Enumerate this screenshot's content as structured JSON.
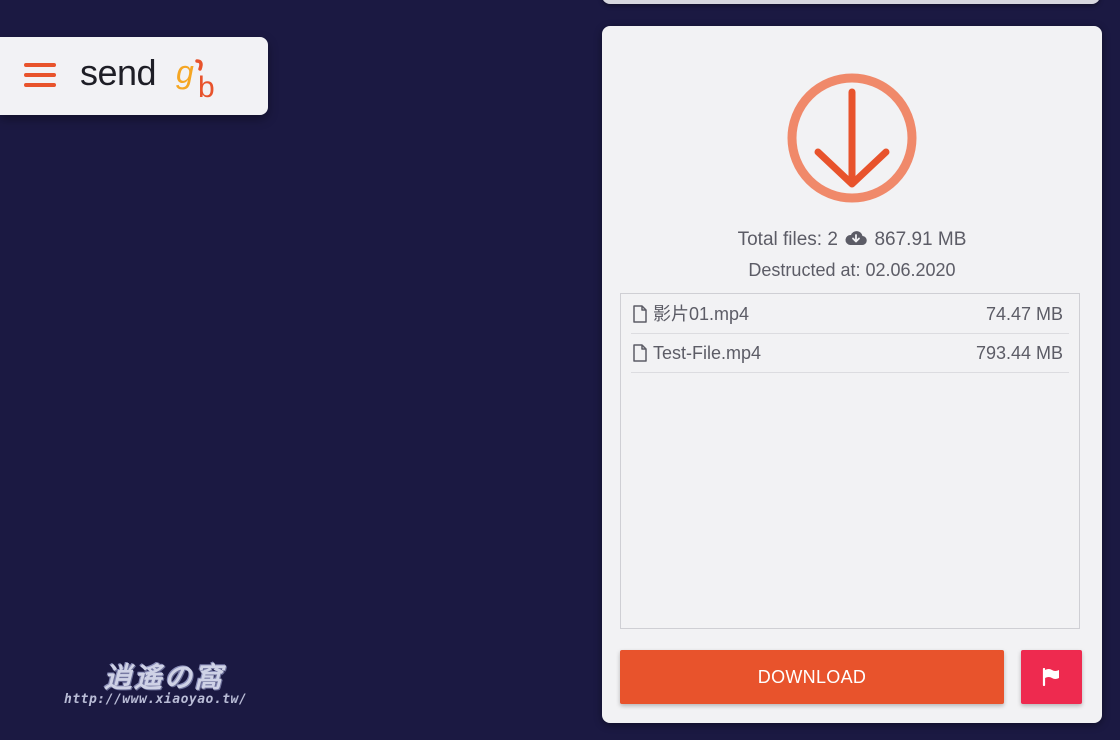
{
  "header": {
    "logo_text": "send gb",
    "menu_icon": "hamburger-menu-icon"
  },
  "panel": {
    "main_icon": "download-arrow-circle-icon",
    "summary": {
      "total_files_label": "Total files: 2",
      "total_size": "867.91 MB",
      "size_icon": "cloud-download-icon",
      "destructed_label": "Destructed at: 02.06.2020"
    },
    "files": [
      {
        "name": "影片01.mp4",
        "size": "74.47 MB",
        "icon": "file-icon"
      },
      {
        "name": "Test-File.mp4",
        "size": "793.44 MB",
        "icon": "file-icon"
      }
    ],
    "download_label": "DOWNLOAD",
    "report_icon": "flag-icon"
  },
  "watermark": {
    "title": "逍遙の窩",
    "url": "http://www.xiaoyao.tw/"
  },
  "colors": {
    "background": "#1b1942",
    "accent_orange": "#e8532c",
    "accent_light_orange": "#f0896a",
    "report_red": "#ee2a4f",
    "panel_bg": "#f2f2f4",
    "text_gray": "#5c5c66"
  }
}
